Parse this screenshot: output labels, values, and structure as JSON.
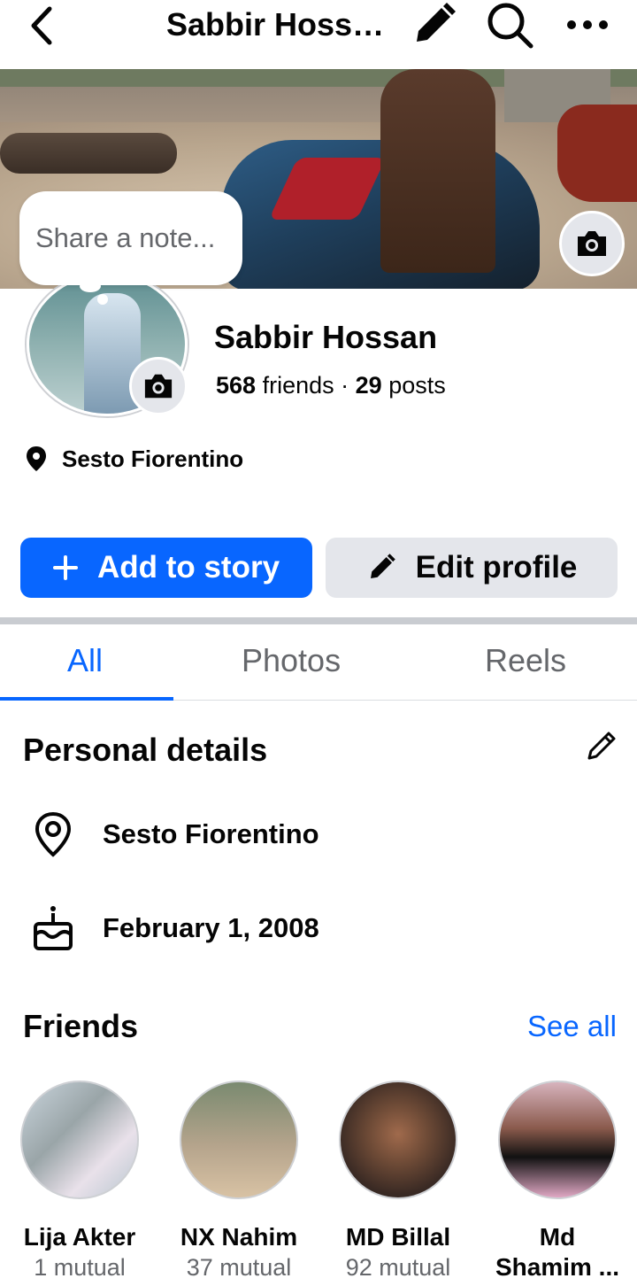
{
  "header": {
    "title": "Sabbir Hossan",
    "icons": [
      "back-arrow-icon",
      "pencil-icon",
      "search-icon",
      "more-icon"
    ]
  },
  "note": {
    "placeholder": "Share a note..."
  },
  "profile": {
    "name": "Sabbir Hossan",
    "friends_count": "568",
    "friends_label": "friends",
    "separator": "·",
    "posts_count": "29",
    "posts_label": "posts",
    "location": "Sesto Fiorentino"
  },
  "actions": {
    "add_story": "Add to story",
    "edit_profile": "Edit profile"
  },
  "tabs": [
    {
      "label": "All",
      "active": true
    },
    {
      "label": "Photos",
      "active": false
    },
    {
      "label": "Reels",
      "active": false
    }
  ],
  "personal_details": {
    "title": "Personal details",
    "location": "Sesto Fiorentino",
    "birthday": "February 1, 2008"
  },
  "friends": {
    "title": "Friends",
    "see_all": "See all",
    "items": [
      {
        "name": "Lija Akter",
        "mutual": "1 mutual",
        "online": false
      },
      {
        "name": "NX Nahim",
        "mutual": "37 mutual",
        "online": true
      },
      {
        "name": "MD Billal",
        "mutual": "92 mutual",
        "online": true
      },
      {
        "name": "Md",
        "name2": "Shamim ...",
        "online": true
      }
    ]
  },
  "colors": {
    "accent": "#0866ff",
    "online": "#31a24c",
    "secondary_text": "#65676b"
  }
}
